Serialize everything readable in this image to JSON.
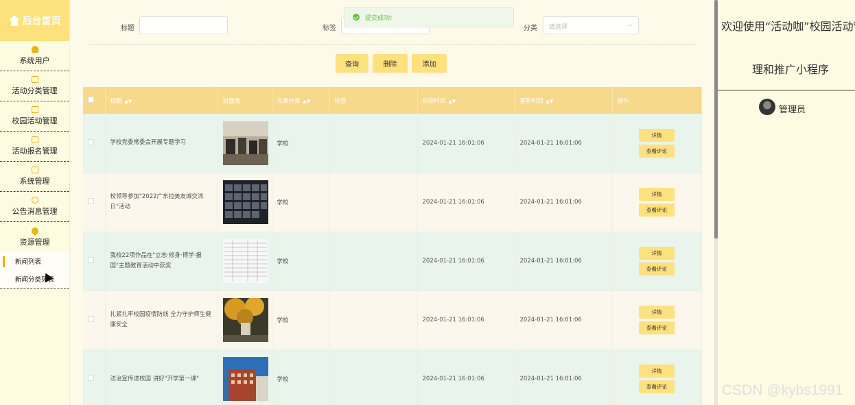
{
  "sidebar": {
    "brand": "后台首页",
    "items": [
      {
        "label": "系统用户",
        "icon": "user-icon"
      },
      {
        "label": "活动分类管理",
        "icon": "edit-icon"
      },
      {
        "label": "校园活动管理",
        "icon": "edit-icon"
      },
      {
        "label": "活动报名管理",
        "icon": "edit-icon"
      },
      {
        "label": "系统管理",
        "icon": "image-icon"
      },
      {
        "label": "公告消息管理",
        "icon": "alert-icon"
      },
      {
        "label": "资源管理",
        "icon": "pin-icon"
      }
    ],
    "submenu": [
      "新闻列表",
      "新闻分类列表"
    ]
  },
  "search": {
    "title_label": "标题",
    "tag_label": "标签",
    "category_label": "分类",
    "category_placeholder": "请选择"
  },
  "toast": {
    "message": "提交成功!"
  },
  "buttons": {
    "query": "查询",
    "delete": "删除",
    "add": "添加"
  },
  "table": {
    "headers": [
      "标题",
      "封面图",
      "文章分类",
      "标签",
      "创建时间",
      "更新时间",
      "操作"
    ],
    "rows": [
      {
        "title": "学校党委常委会开展专题学习",
        "category": "学校",
        "tag": "",
        "created": "2024-01-21 16:01:06",
        "updated": "2024-01-21 16:01:06"
      },
      {
        "title": "校领导参加\"2022广东拉美友城交流日\"活动",
        "category": "学校",
        "tag": "",
        "created": "2024-01-21 16:01:06",
        "updated": "2024-01-21 16:01:06"
      },
      {
        "title": "我校22项作品在\"立志·修身·博学·报国\"主题教育活动中获奖",
        "category": "学校",
        "tag": "",
        "created": "2024-01-21 16:01:06",
        "updated": "2024-01-21 16:01:06"
      },
      {
        "title": "扎紧扎牢校园疫情防线 全力守护师生健康安全",
        "category": "学校",
        "tag": "",
        "created": "2024-01-21 16:01:06",
        "updated": "2024-01-21 16:01:06"
      },
      {
        "title": "法治宣传进校园 讲好\"开学第一课\"",
        "category": "学校",
        "tag": "",
        "created": "2024-01-21 16:01:06",
        "updated": "2024-01-21 16:01:06"
      }
    ],
    "op_detail": "详情",
    "op_comments": "查看评论"
  },
  "right": {
    "welcome_line1": "欢迎使用“活动咖”校园活动管",
    "welcome_line2": "理和推广小程序",
    "user": "管理员"
  },
  "watermark": "CSDN @kybs1991",
  "colors": {
    "accent": "#fde17d",
    "header": "#f7d98b",
    "success": "#67c23a"
  }
}
